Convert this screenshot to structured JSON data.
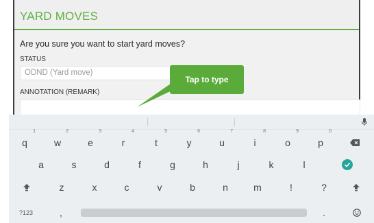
{
  "dialog": {
    "title": "YARD MOVES",
    "question": "Are you sure you want to start yard moves?",
    "status_label": "STATUS",
    "status_value": "ODND (Yard move)",
    "annotation_label": "ANNOTATION (REMARK)",
    "annotation_value": ""
  },
  "tooltip": {
    "text": "Tap to type"
  },
  "colors": {
    "accent": "#5fb043",
    "tooltip": "#5bab3a",
    "keyboard_bg": "#eceff1"
  },
  "keyboard": {
    "row1": [
      {
        "label": "q",
        "num": "1"
      },
      {
        "label": "w",
        "num": "2"
      },
      {
        "label": "e",
        "num": "3"
      },
      {
        "label": "r",
        "num": "4"
      },
      {
        "label": "t",
        "num": "5"
      },
      {
        "label": "y",
        "num": "6"
      },
      {
        "label": "u",
        "num": "7"
      },
      {
        "label": "i",
        "num": "8"
      },
      {
        "label": "o",
        "num": "9"
      },
      {
        "label": "p",
        "num": "0"
      }
    ],
    "row2": [
      "a",
      "s",
      "d",
      "f",
      "g",
      "h",
      "j",
      "k",
      "l"
    ],
    "row3": [
      "z",
      "x",
      "c",
      "v",
      "b",
      "n",
      "m",
      "!",
      "?"
    ],
    "symbols_key": "?123",
    "comma_key": ",",
    "period_key": ".",
    "icons": {
      "backspace": "backspace-icon",
      "enter": "check-circle-icon",
      "shift": "shift-icon",
      "mic": "mic-icon",
      "emoji": "emoji-icon"
    }
  }
}
